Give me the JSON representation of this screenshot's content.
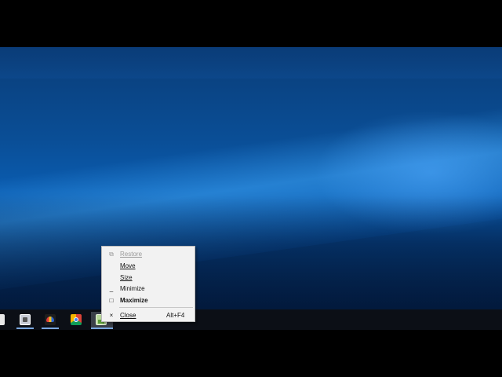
{
  "desktop": {
    "wallpaper": "windows-10-default"
  },
  "taskbar": {
    "items": [
      {
        "name": "edge-app",
        "icon": "edge-icon"
      },
      {
        "name": "camera-app",
        "icon": "camera-icon"
      },
      {
        "name": "people-app",
        "icon": "people-icon"
      },
      {
        "name": "chrome-app",
        "icon": "chrome-icon"
      },
      {
        "name": "active-app",
        "icon": "app-icon",
        "active": true
      }
    ]
  },
  "context_menu": {
    "items": [
      {
        "label": "Restore",
        "glyph": "⧉",
        "enabled": false
      },
      {
        "label": "Move",
        "glyph": "",
        "enabled": true
      },
      {
        "label": "Size",
        "glyph": "",
        "enabled": true
      },
      {
        "label": "Minimize",
        "glyph": "_",
        "enabled": true
      },
      {
        "label": "Maximize",
        "glyph": "□",
        "enabled": true,
        "default": true
      },
      {
        "label": "Close",
        "glyph": "×",
        "accelerator": "Alt+F4",
        "enabled": true
      }
    ]
  },
  "colors": {
    "menu_bg": "#f2f2f2",
    "taskbar_bg": "#0c0f16",
    "disabled_text": "#9a9a9a"
  }
}
